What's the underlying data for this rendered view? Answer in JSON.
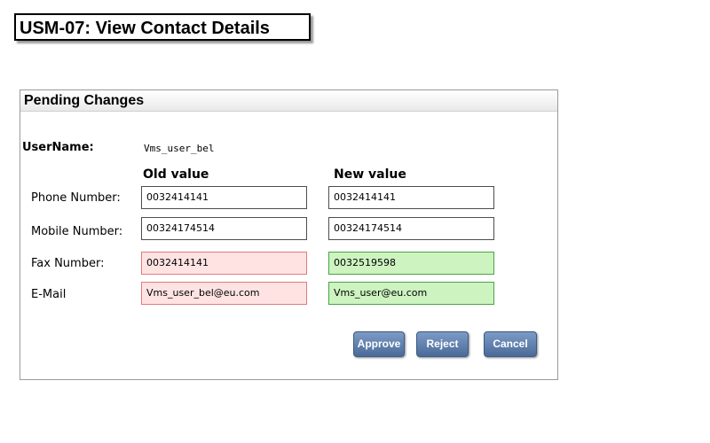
{
  "page": {
    "title": "USM-07: View Contact Details"
  },
  "panel": {
    "title": "Pending Changes",
    "username_label": "UserName:",
    "username_value": "Vms_user_bel",
    "old_value_header": "Old value",
    "new_value_header": "New value",
    "rows": [
      {
        "label": "Phone Number:",
        "old": "0032414141",
        "new": "0032414141"
      },
      {
        "label": "Mobile Number:",
        "old": "00324174514",
        "new": "00324174514"
      },
      {
        "label": "Fax Number:",
        "old": "0032414141",
        "new": "0032519598"
      },
      {
        "label": "E-Mail",
        "old": "Vms_user_bel@eu.com",
        "new": "Vms_user@eu.com"
      }
    ]
  },
  "buttons": {
    "approve": "Approve",
    "reject": "Reject",
    "cancel": "Cancel"
  },
  "colors": {
    "changed_old_bg": "#ffe3e3",
    "changed_new_bg": "#cdf3c0",
    "button_blue": "#5878a8"
  }
}
